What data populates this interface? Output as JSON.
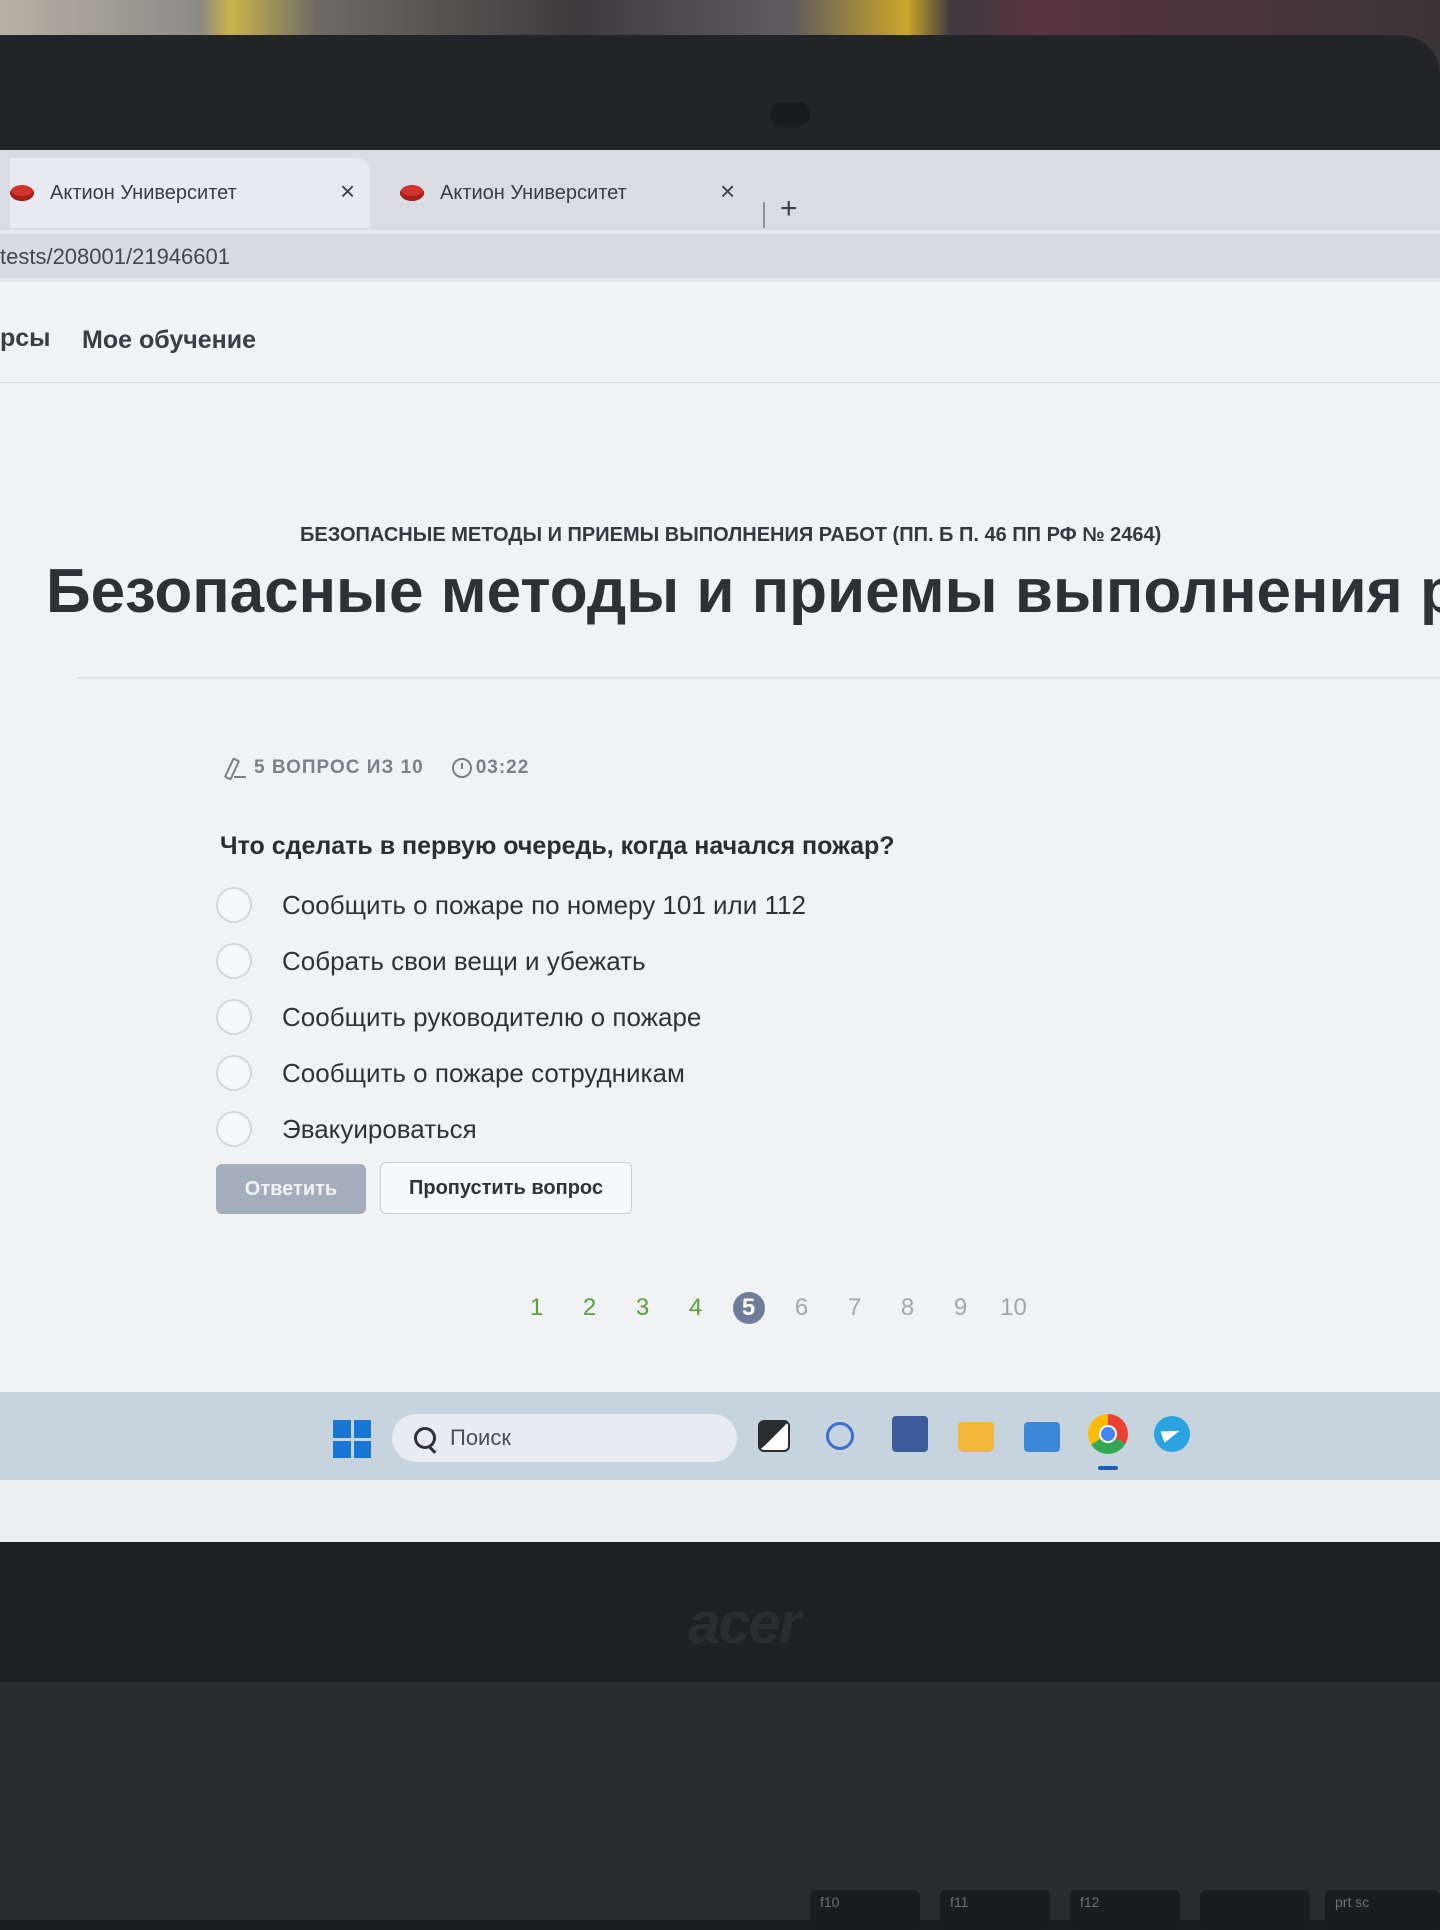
{
  "browser": {
    "tabs": [
      {
        "label": "Актион Университет",
        "close": "×"
      },
      {
        "label": "Актион Университет",
        "close": "×"
      }
    ],
    "new_tab": "+",
    "url": "tests/208001/21946601"
  },
  "site_nav": {
    "items": [
      "рсы",
      "Мое обучение"
    ]
  },
  "test": {
    "course_name": "БЕЗОПАСНЫЕ МЕТОДЫ И ПРИЕМЫ ВЫПОЛНЕНИЯ РАБОТ (ПП. Б П. 46 ПП РФ № 2464)",
    "title": "Безопасные методы и приемы выполнения работ",
    "progress_label": "5 ВОПРОС ИЗ 10",
    "timer": "03:22",
    "question": "Что сделать в первую очередь, когда начался пожар?",
    "options": [
      "Сообщить о пожаре по номеру 101 или 112",
      "Собрать свои вещи и убежать",
      "Сообщить руководителю о пожаре",
      "Сообщить о пожаре сотрудникам",
      "Эвакуироваться"
    ],
    "answer_button": "Ответить",
    "skip_button": "Пропустить вопрос",
    "pages": [
      "1",
      "2",
      "3",
      "4",
      "5",
      "6",
      "7",
      "8",
      "9",
      "10"
    ],
    "current_page": "5"
  },
  "taskbar": {
    "search_placeholder": "Поиск",
    "apps": [
      "task-view",
      "snipping-tool",
      "calculator",
      "file-explorer",
      "photos",
      "chrome",
      "telegram"
    ]
  },
  "laptop": {
    "brand": "acer",
    "keys": [
      "f10",
      "f11",
      "f12",
      "",
      "prt sc"
    ]
  },
  "colors": {
    "accent_current_page": "#6f7d9a",
    "answered_page": "#5aa13c",
    "answer_button_disabled": "#a4adbb",
    "favicon": "#d0342c"
  }
}
